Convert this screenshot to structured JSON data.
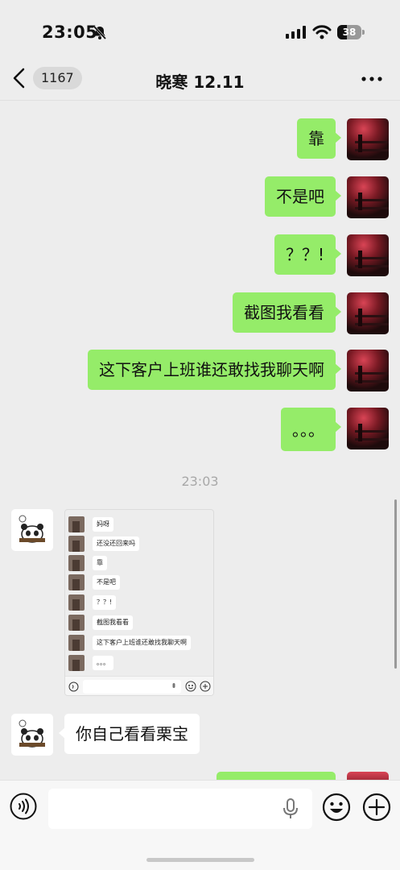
{
  "status_bar": {
    "time": "23:05",
    "battery": "38"
  },
  "nav": {
    "unread_count": "1167",
    "title": "晓寒 12.11"
  },
  "messages_out": [
    {
      "text": "靠"
    },
    {
      "text": "不是吧"
    },
    {
      "text": "？？!"
    },
    {
      "text": "截图我看看"
    },
    {
      "text": "这下客户上班谁还敢找我聊天啊"
    },
    {
      "text": "。。。"
    }
  ],
  "timestamp": "23:03",
  "shared_screenshot": {
    "messages": [
      "妈呀",
      "还没还回来吗",
      "靠",
      "不是吧",
      "？？!",
      "截图我看看",
      "这下客户上班谁还敢找我聊天啊",
      "。。。"
    ]
  },
  "message_in": {
    "text": "你自己看看栗宝"
  },
  "input": {
    "placeholder": ""
  },
  "colors": {
    "bubble_out": "#95ec69",
    "background": "#ededed"
  }
}
